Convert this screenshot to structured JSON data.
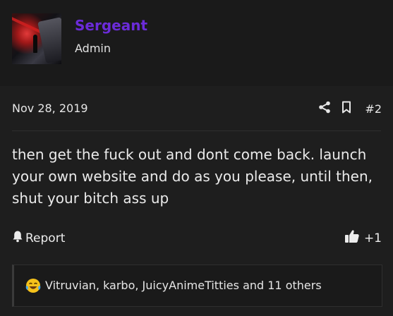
{
  "author": {
    "username": "Sergeant",
    "role": "Admin",
    "avatar_icon": "avatar-image",
    "username_color": "#6b2bd9"
  },
  "post": {
    "date": "Nov 28, 2019",
    "number": "#2",
    "share_icon": "share-icon",
    "bookmark_icon": "bookmark-icon",
    "body": "then get the fuck out and dont come back. launch your own website and do as you please, until then, shut your bitch ass up"
  },
  "footer": {
    "report_label": "Report",
    "report_icon": "bell-icon",
    "like_icon": "thumbs-up-icon",
    "like_label": "+1"
  },
  "reactions": {
    "emoji_icon": "laughing-crying-emoji",
    "text": "Vitruvian, karbo, JuicyAnimeTitties and 11 others"
  }
}
